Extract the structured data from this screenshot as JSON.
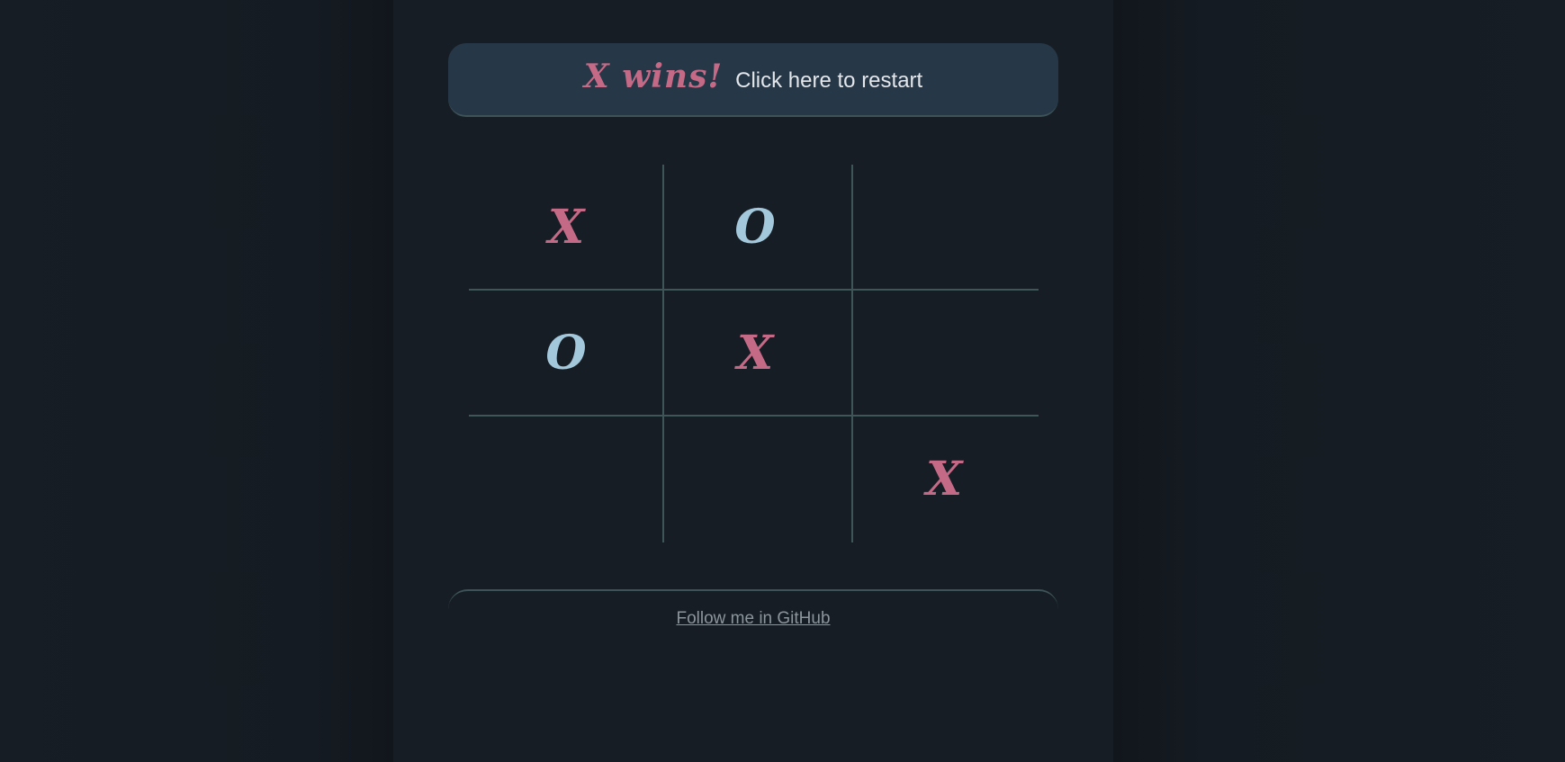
{
  "status": {
    "winner_text": "X wins!",
    "restart_text": "Click here to restart"
  },
  "board": {
    "cells": [
      "X",
      "O",
      "",
      "O",
      "X",
      "",
      "",
      "",
      "X"
    ]
  },
  "footer": {
    "link_text": "Follow me in GitHub"
  },
  "colors": {
    "x_mark": "#c46a86",
    "o_mark": "#a3c8dc",
    "background": "#161d24",
    "banner": "#263747",
    "grid_lines": "#3f5659"
  }
}
